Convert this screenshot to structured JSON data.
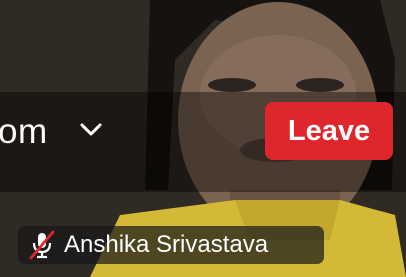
{
  "meeting": {
    "view_label": "om",
    "leave_label": "Leave",
    "participant_name": "Anshika Srivastava"
  },
  "icons": {
    "view_menu": "chevron-down-icon",
    "mic_status": "muted-microphone-icon"
  },
  "colors": {
    "leave_button": "#e0262d",
    "muted_slash": "#e0262d",
    "overlay_text": "#ffffff"
  }
}
